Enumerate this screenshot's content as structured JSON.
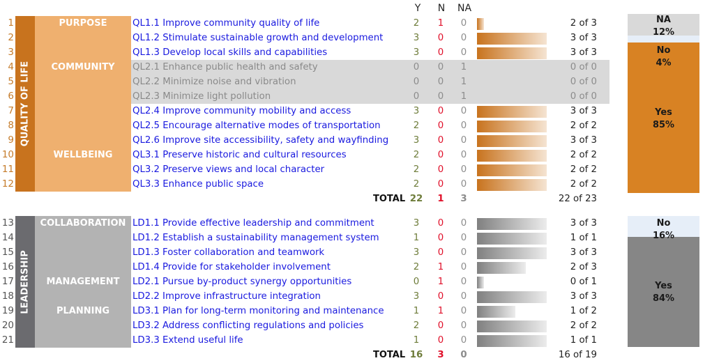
{
  "headers": {
    "y": "Y",
    "n": "N",
    "na": "NA"
  },
  "quality_of_life": {
    "group_label": "QUALITY OF LIFE",
    "colors": {
      "group": "#c8731e",
      "category": "#efb06f",
      "bar_start": "#c8731e",
      "panel": "#d88223"
    },
    "categories": [
      {
        "label": "PURPOSE",
        "row": 1
      },
      {
        "label": "COMMUNITY",
        "row": 4
      },
      {
        "label": "WELLBEING",
        "row": 10
      }
    ],
    "rows": [
      {
        "num": "1",
        "text": "QL1.1 Improve community quality of life",
        "y": "2",
        "n": "1",
        "na": "0",
        "score": "2 of 3",
        "fill": 0.1,
        "applicable": true
      },
      {
        "num": "2",
        "text": "QL1.2 Stimulate sustainable growth and development",
        "y": "3",
        "n": "0",
        "na": "0",
        "score": "3 of 3",
        "fill": 1.0,
        "applicable": true
      },
      {
        "num": "3",
        "text": "QL1.3 Develop local skills and capabilities",
        "y": "3",
        "n": "0",
        "na": "0",
        "score": "3 of 3",
        "fill": 1.0,
        "applicable": true
      },
      {
        "num": "4",
        "text": "QL2.1 Enhance public health and safety",
        "y": "0",
        "n": "0",
        "na": "1",
        "score": "0 of 0",
        "fill": 0,
        "applicable": false
      },
      {
        "num": "5",
        "text": "QL2.2 Minimize noise and vibration",
        "y": "0",
        "n": "0",
        "na": "1",
        "score": "0 of 0",
        "fill": 0,
        "applicable": false
      },
      {
        "num": "6",
        "text": "QL2.3 Minimize light pollution",
        "y": "0",
        "n": "0",
        "na": "1",
        "score": "0 of 0",
        "fill": 0,
        "applicable": false
      },
      {
        "num": "7",
        "text": "QL2.4 Improve community mobility and access",
        "y": "3",
        "n": "0",
        "na": "0",
        "score": "3 of 3",
        "fill": 1.0,
        "applicable": true
      },
      {
        "num": "8",
        "text": "QL2.5 Encourage alternative modes of transportation",
        "y": "2",
        "n": "0",
        "na": "0",
        "score": "2 of 2",
        "fill": 1.0,
        "applicable": true
      },
      {
        "num": "9",
        "text": "QL2.6 Improve site accessibility, safety and wayfinding",
        "y": "3",
        "n": "0",
        "na": "0",
        "score": "3 of 3",
        "fill": 1.0,
        "applicable": true
      },
      {
        "num": "10",
        "text": "QL3.1 Preserve historic and cultural resources",
        "y": "2",
        "n": "0",
        "na": "0",
        "score": "2 of 2",
        "fill": 1.0,
        "applicable": true
      },
      {
        "num": "11",
        "text": "QL3.2 Preserve views and local character",
        "y": "2",
        "n": "0",
        "na": "0",
        "score": "2 of 2",
        "fill": 1.0,
        "applicable": true
      },
      {
        "num": "12",
        "text": "QL3.3 Enhance public space",
        "y": "2",
        "n": "0",
        "na": "0",
        "score": "2 of 2",
        "fill": 1.0,
        "applicable": true
      }
    ],
    "total": {
      "label": "TOTAL",
      "y": "22",
      "n": "1",
      "na": "3",
      "score": "22 of 23"
    },
    "summary": [
      {
        "label": "NA",
        "value": "12%",
        "fraction": 0.12,
        "color": "#d9d9d9"
      },
      {
        "label": "No",
        "value": "4%",
        "fraction": 0.04,
        "color": "#e6eef8"
      },
      {
        "label": "Yes",
        "value": "85%",
        "fraction": 0.85,
        "color": "#d88223"
      }
    ]
  },
  "leadership": {
    "group_label": "LEADERSHIP",
    "colors": {
      "group": "#6b6b6f",
      "category": "#b3b3b3",
      "bar_start": "#808080",
      "panel": "#868686"
    },
    "categories": [
      {
        "label": "COLLABORATION",
        "row": 1
      },
      {
        "label": "MANAGEMENT",
        "row": 5
      },
      {
        "label": "PLANNING",
        "row": 7
      }
    ],
    "rows": [
      {
        "num": "13",
        "text": "LD1.1 Provide effective leadership and commitment",
        "y": "3",
        "n": "0",
        "na": "0",
        "score": "3 of 3",
        "fill": 1.0,
        "applicable": true
      },
      {
        "num": "14",
        "text": "LD1.2 Establish a sustainability management system",
        "y": "1",
        "n": "0",
        "na": "0",
        "score": "1 of 1",
        "fill": 1.0,
        "applicable": true
      },
      {
        "num": "15",
        "text": "LD1.3 Foster collaboration and teamwork",
        "y": "3",
        "n": "0",
        "na": "0",
        "score": "3 of 3",
        "fill": 1.0,
        "applicable": true
      },
      {
        "num": "16",
        "text": "LD1.4 Provide for stakeholder involvement",
        "y": "2",
        "n": "1",
        "na": "0",
        "score": "2 of 3",
        "fill": 0.7,
        "applicable": true
      },
      {
        "num": "17",
        "text": "LD2.1 Pursue by-product synergy opportunities",
        "y": "0",
        "n": "1",
        "na": "0",
        "score": "0 of 1",
        "fill": 0.1,
        "applicable": true
      },
      {
        "num": "18",
        "text": "LD2.2 Improve infrastructure integration",
        "y": "3",
        "n": "0",
        "na": "0",
        "score": "3 of 3",
        "fill": 1.0,
        "applicable": true
      },
      {
        "num": "19",
        "text": "LD3.1 Plan for long-term monitoring and maintenance",
        "y": "1",
        "n": "1",
        "na": "0",
        "score": "1 of 2",
        "fill": 0.55,
        "applicable": true
      },
      {
        "num": "20",
        "text": "LD3.2 Address conflicting regulations and policies",
        "y": "2",
        "n": "0",
        "na": "0",
        "score": "2 of 2",
        "fill": 1.0,
        "applicable": true
      },
      {
        "num": "21",
        "text": "LD3.3 Extend useful life",
        "y": "1",
        "n": "0",
        "na": "0",
        "score": "1 of 1",
        "fill": 1.0,
        "applicable": true
      }
    ],
    "total": {
      "label": "TOTAL",
      "y": "16",
      "n": "3",
      "na": "0",
      "score": "16 of 19"
    },
    "summary": [
      {
        "label": "No",
        "value": "16%",
        "fraction": 0.16,
        "color": "#e6eef8"
      },
      {
        "label": "Yes",
        "value": "84%",
        "fraction": 0.84,
        "color": "#868686"
      }
    ]
  }
}
